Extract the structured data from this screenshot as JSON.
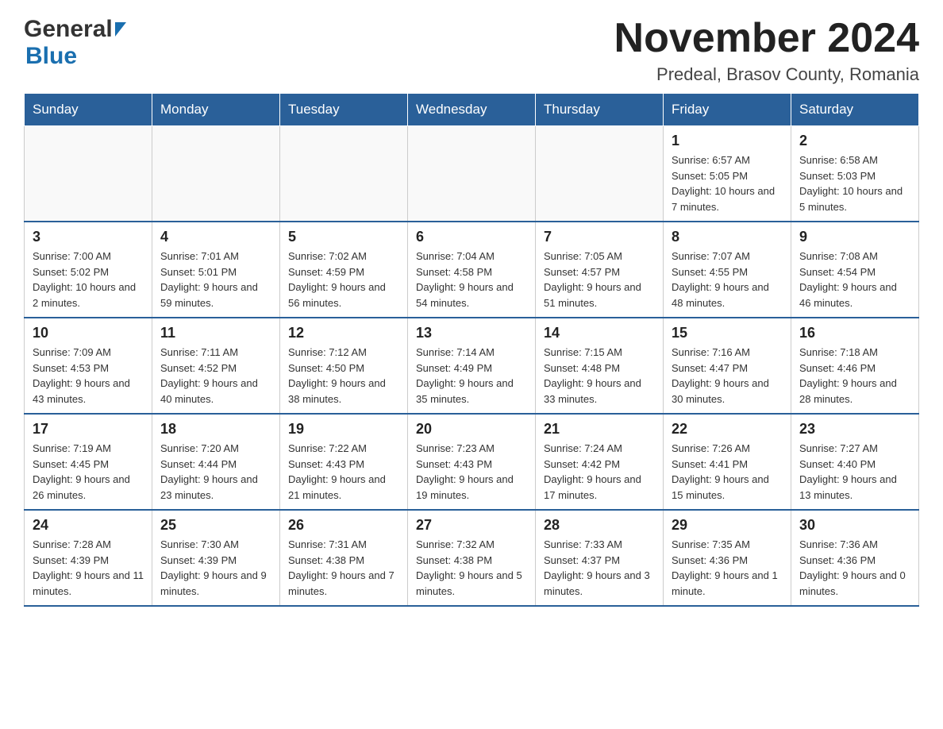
{
  "logo": {
    "general": "General",
    "blue": "Blue"
  },
  "title": "November 2024",
  "location": "Predeal, Brasov County, Romania",
  "weekdays": [
    "Sunday",
    "Monday",
    "Tuesday",
    "Wednesday",
    "Thursday",
    "Friday",
    "Saturday"
  ],
  "weeks": [
    [
      {
        "day": "",
        "info": ""
      },
      {
        "day": "",
        "info": ""
      },
      {
        "day": "",
        "info": ""
      },
      {
        "day": "",
        "info": ""
      },
      {
        "day": "",
        "info": ""
      },
      {
        "day": "1",
        "info": "Sunrise: 6:57 AM\nSunset: 5:05 PM\nDaylight: 10 hours and 7 minutes."
      },
      {
        "day": "2",
        "info": "Sunrise: 6:58 AM\nSunset: 5:03 PM\nDaylight: 10 hours and 5 minutes."
      }
    ],
    [
      {
        "day": "3",
        "info": "Sunrise: 7:00 AM\nSunset: 5:02 PM\nDaylight: 10 hours and 2 minutes."
      },
      {
        "day": "4",
        "info": "Sunrise: 7:01 AM\nSunset: 5:01 PM\nDaylight: 9 hours and 59 minutes."
      },
      {
        "day": "5",
        "info": "Sunrise: 7:02 AM\nSunset: 4:59 PM\nDaylight: 9 hours and 56 minutes."
      },
      {
        "day": "6",
        "info": "Sunrise: 7:04 AM\nSunset: 4:58 PM\nDaylight: 9 hours and 54 minutes."
      },
      {
        "day": "7",
        "info": "Sunrise: 7:05 AM\nSunset: 4:57 PM\nDaylight: 9 hours and 51 minutes."
      },
      {
        "day": "8",
        "info": "Sunrise: 7:07 AM\nSunset: 4:55 PM\nDaylight: 9 hours and 48 minutes."
      },
      {
        "day": "9",
        "info": "Sunrise: 7:08 AM\nSunset: 4:54 PM\nDaylight: 9 hours and 46 minutes."
      }
    ],
    [
      {
        "day": "10",
        "info": "Sunrise: 7:09 AM\nSunset: 4:53 PM\nDaylight: 9 hours and 43 minutes."
      },
      {
        "day": "11",
        "info": "Sunrise: 7:11 AM\nSunset: 4:52 PM\nDaylight: 9 hours and 40 minutes."
      },
      {
        "day": "12",
        "info": "Sunrise: 7:12 AM\nSunset: 4:50 PM\nDaylight: 9 hours and 38 minutes."
      },
      {
        "day": "13",
        "info": "Sunrise: 7:14 AM\nSunset: 4:49 PM\nDaylight: 9 hours and 35 minutes."
      },
      {
        "day": "14",
        "info": "Sunrise: 7:15 AM\nSunset: 4:48 PM\nDaylight: 9 hours and 33 minutes."
      },
      {
        "day": "15",
        "info": "Sunrise: 7:16 AM\nSunset: 4:47 PM\nDaylight: 9 hours and 30 minutes."
      },
      {
        "day": "16",
        "info": "Sunrise: 7:18 AM\nSunset: 4:46 PM\nDaylight: 9 hours and 28 minutes."
      }
    ],
    [
      {
        "day": "17",
        "info": "Sunrise: 7:19 AM\nSunset: 4:45 PM\nDaylight: 9 hours and 26 minutes."
      },
      {
        "day": "18",
        "info": "Sunrise: 7:20 AM\nSunset: 4:44 PM\nDaylight: 9 hours and 23 minutes."
      },
      {
        "day": "19",
        "info": "Sunrise: 7:22 AM\nSunset: 4:43 PM\nDaylight: 9 hours and 21 minutes."
      },
      {
        "day": "20",
        "info": "Sunrise: 7:23 AM\nSunset: 4:43 PM\nDaylight: 9 hours and 19 minutes."
      },
      {
        "day": "21",
        "info": "Sunrise: 7:24 AM\nSunset: 4:42 PM\nDaylight: 9 hours and 17 minutes."
      },
      {
        "day": "22",
        "info": "Sunrise: 7:26 AM\nSunset: 4:41 PM\nDaylight: 9 hours and 15 minutes."
      },
      {
        "day": "23",
        "info": "Sunrise: 7:27 AM\nSunset: 4:40 PM\nDaylight: 9 hours and 13 minutes."
      }
    ],
    [
      {
        "day": "24",
        "info": "Sunrise: 7:28 AM\nSunset: 4:39 PM\nDaylight: 9 hours and 11 minutes."
      },
      {
        "day": "25",
        "info": "Sunrise: 7:30 AM\nSunset: 4:39 PM\nDaylight: 9 hours and 9 minutes."
      },
      {
        "day": "26",
        "info": "Sunrise: 7:31 AM\nSunset: 4:38 PM\nDaylight: 9 hours and 7 minutes."
      },
      {
        "day": "27",
        "info": "Sunrise: 7:32 AM\nSunset: 4:38 PM\nDaylight: 9 hours and 5 minutes."
      },
      {
        "day": "28",
        "info": "Sunrise: 7:33 AM\nSunset: 4:37 PM\nDaylight: 9 hours and 3 minutes."
      },
      {
        "day": "29",
        "info": "Sunrise: 7:35 AM\nSunset: 4:36 PM\nDaylight: 9 hours and 1 minute."
      },
      {
        "day": "30",
        "info": "Sunrise: 7:36 AM\nSunset: 4:36 PM\nDaylight: 9 hours and 0 minutes."
      }
    ]
  ]
}
